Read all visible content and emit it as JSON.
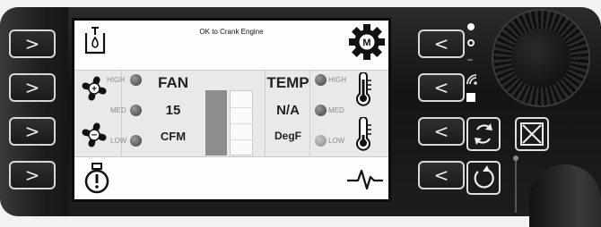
{
  "status": {
    "message": "OK to Crank Engine"
  },
  "fan": {
    "label": "FAN",
    "value": "15",
    "unit": "CFM",
    "high_label": "HIGH",
    "med_label": "MED",
    "low_label": "LOW"
  },
  "temp": {
    "label": "TEMP",
    "value": "N/A",
    "unit": "DegF",
    "high_label": "HIGH",
    "med_label": "MED",
    "low_label": "LOW"
  },
  "left_buttons": [
    ">",
    ">",
    ">",
    ">"
  ],
  "right_buttons": [
    "<",
    "<",
    "<",
    "<"
  ],
  "colors": {
    "bezel": "#1a1a1a",
    "screen": "#fdfdfd",
    "band": "#e9e9e9",
    "led_off": "#555555",
    "button_border": "#d8d8d8"
  },
  "icons": [
    "fuel-level-icon",
    "settings-m-icon",
    "fan-increase-icon",
    "fan-decrease-icon",
    "thermometer-high-icon",
    "thermometer-low-icon",
    "warning-icon",
    "heartbeat-icon",
    "refresh-icon",
    "close-x-icon",
    "reset-icon",
    "rotary-knob"
  ]
}
